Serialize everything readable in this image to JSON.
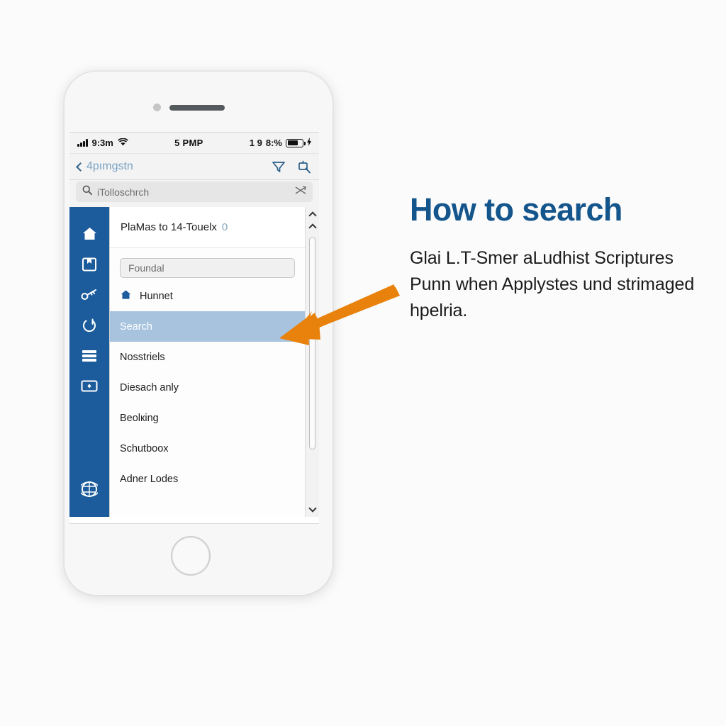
{
  "phone": {
    "status_bar": {
      "signal_icon": "signal-bars-icon",
      "time": "9:3m",
      "wifi_icon": "wifi-icon",
      "carrier": "5 PMP",
      "rotation_lock": "1 9",
      "battery_percent": "8:%",
      "battery_icon": "battery-icon",
      "charging_icon": "lightning-bolt-icon"
    },
    "nav_bar": {
      "back_label": "4pımgstn",
      "back_icon": "chevron-left-icon",
      "filter_icon": "funnel-filter-icon",
      "search_flag_icon": "search-flag-icon"
    },
    "search": {
      "icon": "magnifier-icon",
      "placeholder": "iTolloschrch",
      "clear_icon": "shuffle-clear-icon"
    },
    "sidebar": {
      "items": [
        {
          "icon": "home-icon",
          "name": "sidebar-item-home"
        },
        {
          "icon": "book-icon",
          "name": "sidebar-item-library"
        },
        {
          "icon": "key-icon",
          "name": "sidebar-item-keys"
        },
        {
          "icon": "power-icon",
          "name": "sidebar-item-power"
        },
        {
          "icon": "menu-icon",
          "name": "sidebar-item-menu"
        },
        {
          "icon": "card-icon",
          "name": "sidebar-item-card"
        }
      ],
      "bottom_item": {
        "icon": "globe-icon",
        "name": "sidebar-item-globe"
      }
    },
    "list": {
      "header": "PlaMas to 14-Touelx",
      "header_count": "0",
      "filter_placeholder": "Foundal",
      "items": [
        {
          "label": "Hunnet",
          "icon": "home-icon",
          "selected": false
        },
        {
          "label": "Search",
          "icon": "",
          "selected": true
        },
        {
          "label": "Nosstriels",
          "icon": "",
          "selected": false
        },
        {
          "label": "Diesach anly",
          "icon": "",
          "selected": false
        },
        {
          "label": "Beolкing",
          "icon": "",
          "selected": false
        },
        {
          "label": "Schutboox",
          "icon": "",
          "selected": false
        },
        {
          "label": "Adner Lodes",
          "icon": "",
          "selected": false
        }
      ]
    },
    "scrollbar": {
      "up_icon": "chevron-up-icon",
      "down_icon": "chevron-down-icon"
    },
    "hardware": {
      "camera": "front-camera",
      "speaker": "earpiece-speaker",
      "home_button": "home-button"
    }
  },
  "annotation": {
    "arrow_icon": "callout-arrow-icon",
    "arrow_color": "#e8820c"
  },
  "text_panel": {
    "title": "How to search",
    "body": "Glai L.T-Smer aLudhist Scriptures Punn when Applystes und strimaged hpelria."
  },
  "colors": {
    "sidebar_blue": "#1c5c9c",
    "selected_row": "#a7c3de",
    "title_blue": "#14558c",
    "accent_orange": "#e8820c",
    "page_background": "#fbfbfb"
  }
}
